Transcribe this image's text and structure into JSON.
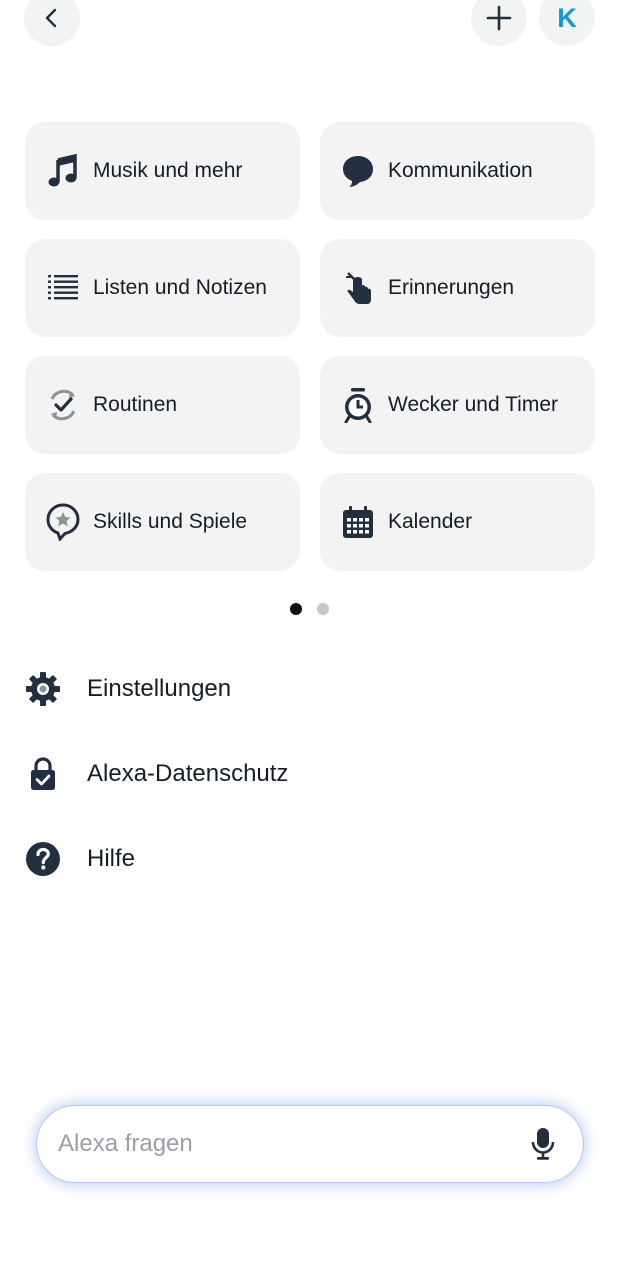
{
  "header": {
    "back_icon": "chevron-left-icon",
    "add_icon": "plus-icon",
    "avatar_letter": "K",
    "avatar_color": "#1399d2"
  },
  "tiles": [
    {
      "label": "Musik und mehr",
      "icon": "music-note-icon"
    },
    {
      "label": "Kommunikation",
      "icon": "speech-bubble-icon"
    },
    {
      "label": "Listen und Notizen",
      "icon": "list-icon"
    },
    {
      "label": "Erinnerungen",
      "icon": "reminder-finger-icon"
    },
    {
      "label": "Routinen",
      "icon": "routine-check-icon"
    },
    {
      "label": "Wecker und Timer",
      "icon": "alarm-clock-icon"
    },
    {
      "label": "Skills und Spiele",
      "icon": "skills-star-icon"
    },
    {
      "label": "Kalender",
      "icon": "calendar-icon"
    }
  ],
  "pager": {
    "pages": 2,
    "active": 1
  },
  "menu": [
    {
      "label": "Einstellungen",
      "icon": "gear-icon"
    },
    {
      "label": "Alexa-Datenschutz",
      "icon": "lock-check-icon"
    },
    {
      "label": "Hilfe",
      "icon": "help-icon"
    }
  ],
  "ask": {
    "placeholder": "Alexa fragen",
    "mic_icon": "microphone-icon"
  }
}
